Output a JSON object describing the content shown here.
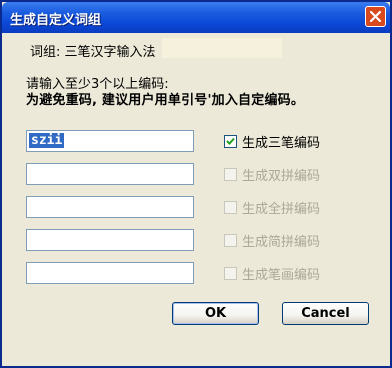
{
  "window": {
    "title": "生成自定义词组"
  },
  "group": {
    "label": "词组: 三笔汉字输入法"
  },
  "instructions": {
    "line1": "请输入至少3个以上编码:",
    "line2": "为避免重码, 建议用户用单引号'加入自定编码。"
  },
  "codes": [
    {
      "value": "szii"
    },
    {
      "value": ""
    },
    {
      "value": ""
    },
    {
      "value": ""
    },
    {
      "value": ""
    }
  ],
  "options": [
    {
      "label": "生成三笔编码",
      "checked": true,
      "enabled": true
    },
    {
      "label": "生成双拼编码",
      "checked": false,
      "enabled": false
    },
    {
      "label": "生成全拼编码",
      "checked": false,
      "enabled": false
    },
    {
      "label": "生成简拼编码",
      "checked": false,
      "enabled": false
    },
    {
      "label": "生成笔画编码",
      "checked": false,
      "enabled": false
    }
  ],
  "buttons": {
    "ok": "OK",
    "cancel": "Cancel"
  },
  "colors": {
    "titlebar": "#0b48d6",
    "face": "#ece9d8",
    "selection": "#316ac5",
    "disabled_text": "#aca899"
  }
}
